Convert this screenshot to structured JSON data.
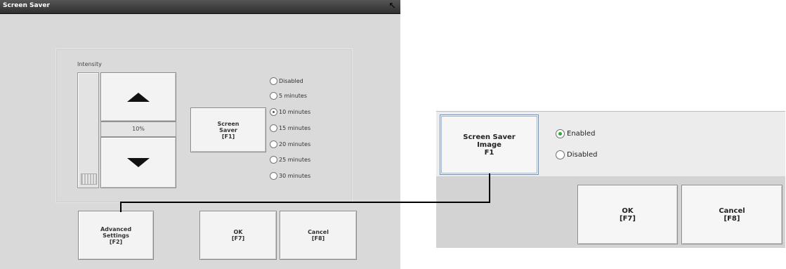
{
  "left_window": {
    "title": "Screen Saver",
    "intensity_label": "Intensity",
    "intensity_level_text": "10%",
    "intensity_level": 0.1,
    "screen_saver_button": [
      "Screen",
      "Saver",
      "[F1]"
    ],
    "timeout_options": [
      "Disabled",
      "5 minutes",
      "10 minutes",
      "15 minutes",
      "20 minutes",
      "25 minutes",
      "30 minutes"
    ],
    "selected_timeout": "10 minutes",
    "advanced_settings_button": [
      "Advanced",
      "Settings",
      "[F2]"
    ],
    "ok_button": [
      "OK",
      "[F7]"
    ],
    "cancel_button": [
      "Cancel",
      "[F8]"
    ]
  },
  "right_window": {
    "screen_saver_image_button": [
      "Screen Saver",
      "Image",
      "F1"
    ],
    "options": [
      "Enabled",
      "Disabled"
    ],
    "selected_option": "Enabled",
    "ok_button": [
      "OK",
      "[F7]"
    ],
    "cancel_button": [
      "Cancel",
      "[F8]"
    ]
  }
}
